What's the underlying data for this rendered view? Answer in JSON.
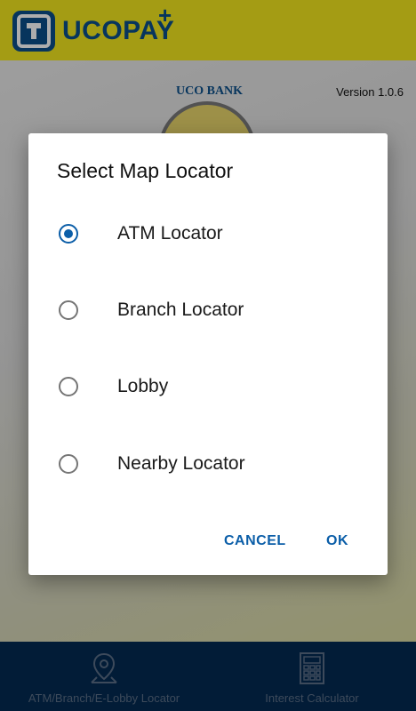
{
  "app": {
    "brand": "UCOPAY",
    "brand_plus": "+",
    "bank_name": "UCO BANK",
    "version": "Version 1.0.6"
  },
  "dialog": {
    "title": "Select Map Locator",
    "options": [
      {
        "label": "ATM Locator",
        "checked": true
      },
      {
        "label": "Branch Locator",
        "checked": false
      },
      {
        "label": "Lobby",
        "checked": false
      },
      {
        "label": "Nearby Locator",
        "checked": false
      }
    ],
    "cancel_label": "CANCEL",
    "ok_label": "OK"
  },
  "bottom_nav": {
    "items": [
      {
        "label": "ATM/Branch/E-Lobby Locator",
        "icon": "map-pin-icon"
      },
      {
        "label": "Interest Calculator",
        "icon": "calculator-icon"
      }
    ]
  },
  "colors": {
    "header_yellow": "#f2e61e",
    "brand_blue": "#0b4f8a",
    "accent": "#0b5ea8",
    "nav_bg": "#032a52"
  }
}
